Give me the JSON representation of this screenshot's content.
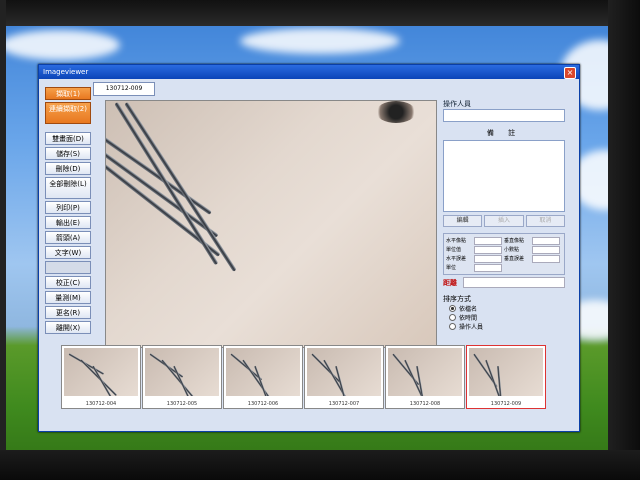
{
  "window": {
    "title": "Imageviewer",
    "close_label": "×"
  },
  "tab": {
    "label": "130712-009"
  },
  "left_panel": {
    "buttons": [
      {
        "label": "擷取(1)",
        "style": "orange"
      },
      {
        "label": "連續擷取(2)",
        "style": "orange"
      },
      {
        "label": "雙畫面(D)",
        "style": "normal"
      },
      {
        "label": "儲存(S)",
        "style": "normal"
      },
      {
        "label": "刪除(D)",
        "style": "normal"
      },
      {
        "label": "全部刪除(L)",
        "style": "normal"
      },
      {
        "label": "列印(P)",
        "style": "normal"
      },
      {
        "label": "輸出(E)",
        "style": "normal"
      },
      {
        "label": "箭頭(A)",
        "style": "normal"
      },
      {
        "label": "文字(W)",
        "style": "normal"
      },
      {
        "label": "",
        "style": "disabled"
      },
      {
        "label": "校正(C)",
        "style": "normal"
      },
      {
        "label": "量測(M)",
        "style": "normal"
      },
      {
        "label": "更名(R)",
        "style": "normal"
      },
      {
        "label": "離開(X)",
        "style": "normal"
      }
    ]
  },
  "right_panel": {
    "operator_label": "操作人員",
    "notes_label": "備 註",
    "notes_buttons": [
      "編輯",
      "插入",
      "取消"
    ],
    "measure_labels": [
      "水平像點",
      "垂直像點",
      "單位值",
      "小數點",
      "水平誤差",
      "垂直誤差",
      "單位"
    ],
    "distance_label": "距離",
    "sort_label": "排序方式",
    "sort_options": [
      "依檔名",
      "依時間",
      "操作人員"
    ]
  },
  "thumbnails": [
    {
      "caption": "130712-004"
    },
    {
      "caption": "130712-005"
    },
    {
      "caption": "130712-006"
    },
    {
      "caption": "130712-007"
    },
    {
      "caption": "130712-008"
    },
    {
      "caption": "130712-009"
    }
  ],
  "colors": {
    "accent_orange": "#e87820",
    "titlebar_blue": "#0b44b8",
    "distance_red": "#c01010"
  }
}
